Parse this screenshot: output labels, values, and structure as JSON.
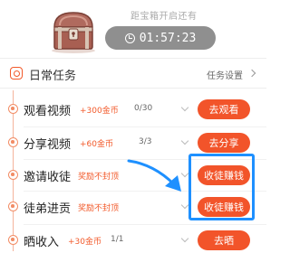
{
  "treasure": {
    "countdown_label": "距宝箱开启还有",
    "timer": "01:57:23"
  },
  "section": {
    "title": "日常任务",
    "settings_label": "任务设置"
  },
  "tasks": [
    {
      "name": "观看视频",
      "reward": "+300金币",
      "progress": "0/30",
      "button": "去观看"
    },
    {
      "name": "分享视频",
      "reward": "+60金币",
      "progress": "3/3",
      "button": "去分享"
    },
    {
      "name": "邀请收徒",
      "reward": "奖励不封顶",
      "progress": "",
      "button": "收徒赚钱"
    },
    {
      "name": "徒弟进贡",
      "reward": "奖励不封顶",
      "progress": "",
      "button": "收徒赚钱"
    },
    {
      "name": "晒收入",
      "reward": "+30金币",
      "progress": "1/1",
      "button": "去晒"
    }
  ],
  "colors": {
    "accent": "#f2542a",
    "timer_bg": "#8f8f8f",
    "highlight": "#1e90ff"
  }
}
